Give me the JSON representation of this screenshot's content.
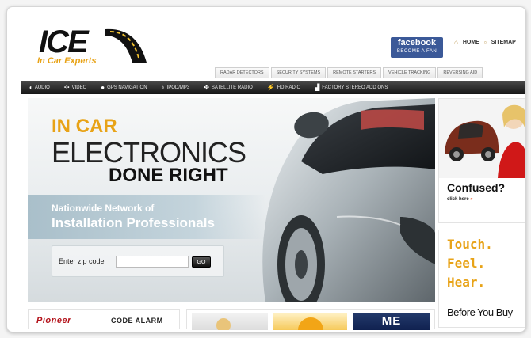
{
  "logo": {
    "main": "ICE",
    "tagline": "In Car Experts"
  },
  "facebook": {
    "line1": "facebook",
    "line2": "BECOME A FAN"
  },
  "toplinks": {
    "home": "HOME",
    "sitemap": "SITEMAP"
  },
  "subnav": [
    "RADAR DETECTORS",
    "SECURITY SYSTEMS",
    "REMOTE STARTERS",
    "VEHICLE TRACKING",
    "REVERSING AID"
  ],
  "mainnav": [
    {
      "icon": "speaker-icon",
      "label": "AUDIO"
    },
    {
      "icon": "film-icon",
      "label": "VIDEO"
    },
    {
      "icon": "globe-icon",
      "label": "GPS NAVIGATION"
    },
    {
      "icon": "music-icon",
      "label": "IPOD/MP3"
    },
    {
      "icon": "satellite-icon",
      "label": "SATELLITE RADIO"
    },
    {
      "icon": "radio-icon",
      "label": "HD RADIO"
    },
    {
      "icon": "car-icon",
      "label": "FACTORY STEREO ADD ONS"
    }
  ],
  "hero": {
    "line1": "IN CAR",
    "line2": "ELECTRONICS",
    "line3": "DONE RIGHT",
    "band1": "Nationwide Network of",
    "band2": "Installation Professionals",
    "zip_label": "Enter zip code",
    "zip_placeholder": "",
    "go": "GO"
  },
  "ads": {
    "confused": "Confused?",
    "click_here": "click here",
    "arrows": "»",
    "touch": "Touch.",
    "feel": "Feel.",
    "hear": "Hear.",
    "before": "Before You Buy"
  },
  "brands": {
    "pioneer": "Pioneer",
    "codealarm": "CODE ALARM"
  },
  "promos": {
    "third": "ME"
  },
  "colors": {
    "accent": "#e8a317",
    "nav": "#1f1f1f",
    "facebook": "#3b5998"
  }
}
